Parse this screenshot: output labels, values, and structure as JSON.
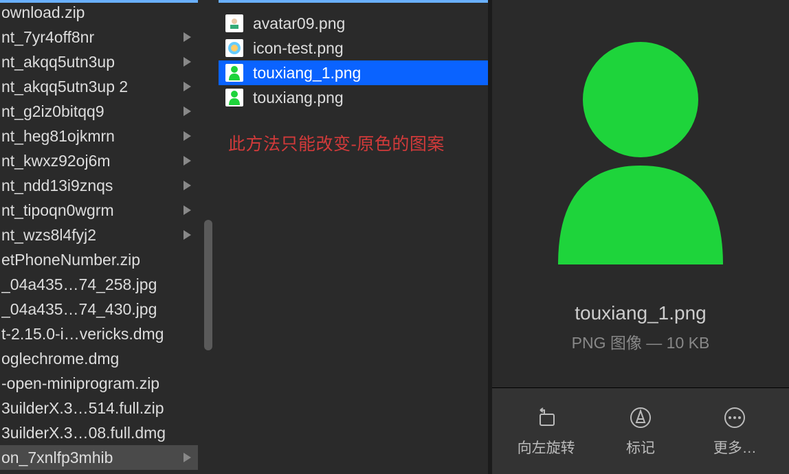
{
  "sidebar": {
    "items": [
      {
        "name": "ownload.zip",
        "has_chevron": false,
        "selected": false
      },
      {
        "name": "nt_7yr4off8nr",
        "has_chevron": true,
        "selected": false
      },
      {
        "name": "nt_akqq5utn3up",
        "has_chevron": true,
        "selected": false
      },
      {
        "name": "nt_akqq5utn3up 2",
        "has_chevron": true,
        "selected": false
      },
      {
        "name": "nt_g2iz0bitqq9",
        "has_chevron": true,
        "selected": false
      },
      {
        "name": "nt_heg81ojkmrn",
        "has_chevron": true,
        "selected": false
      },
      {
        "name": "nt_kwxz92oj6m",
        "has_chevron": true,
        "selected": false
      },
      {
        "name": "nt_ndd13i9znqs",
        "has_chevron": true,
        "selected": false
      },
      {
        "name": "nt_tipoqn0wgrm",
        "has_chevron": true,
        "selected": false
      },
      {
        "name": "nt_wzs8l4fyj2",
        "has_chevron": true,
        "selected": false
      },
      {
        "name": "etPhoneNumber.zip",
        "has_chevron": false,
        "selected": false
      },
      {
        "name": "_04a435…74_258.jpg",
        "has_chevron": false,
        "selected": false
      },
      {
        "name": "_04a435…74_430.jpg",
        "has_chevron": false,
        "selected": false
      },
      {
        "name": "t-2.15.0-i…vericks.dmg",
        "has_chevron": false,
        "selected": false
      },
      {
        "name": "oglechrome.dmg",
        "has_chevron": false,
        "selected": false
      },
      {
        "name": "-open-miniprogram.zip",
        "has_chevron": false,
        "selected": false
      },
      {
        "name": "3uilderX.3…514.full.zip",
        "has_chevron": false,
        "selected": false
      },
      {
        "name": "3uilderX.3…08.full.dmg",
        "has_chevron": false,
        "selected": false
      },
      {
        "name": "on_7xnlfp3mhib",
        "has_chevron": true,
        "selected": true
      }
    ]
  },
  "files": {
    "items": [
      {
        "name": "avatar09.png",
        "selected": false,
        "thumb": "avatar09"
      },
      {
        "name": "icon-test.png",
        "selected": false,
        "thumb": "icontest"
      },
      {
        "name": "touxiang_1.png",
        "selected": true,
        "thumb": "touxiang1"
      },
      {
        "name": "touxiang.png",
        "selected": false,
        "thumb": "touxiang"
      }
    ]
  },
  "annotation": {
    "text": "此方法只能改变-原色的图案"
  },
  "preview": {
    "filename": "touxiang_1.png",
    "subtitle": "PNG 图像 — 10 KB",
    "icon_color": "#1ed43b"
  },
  "actions": {
    "rotate_left": {
      "label": "向左旋转"
    },
    "markup": {
      "label": "标记"
    },
    "more": {
      "label": "更多…"
    }
  }
}
